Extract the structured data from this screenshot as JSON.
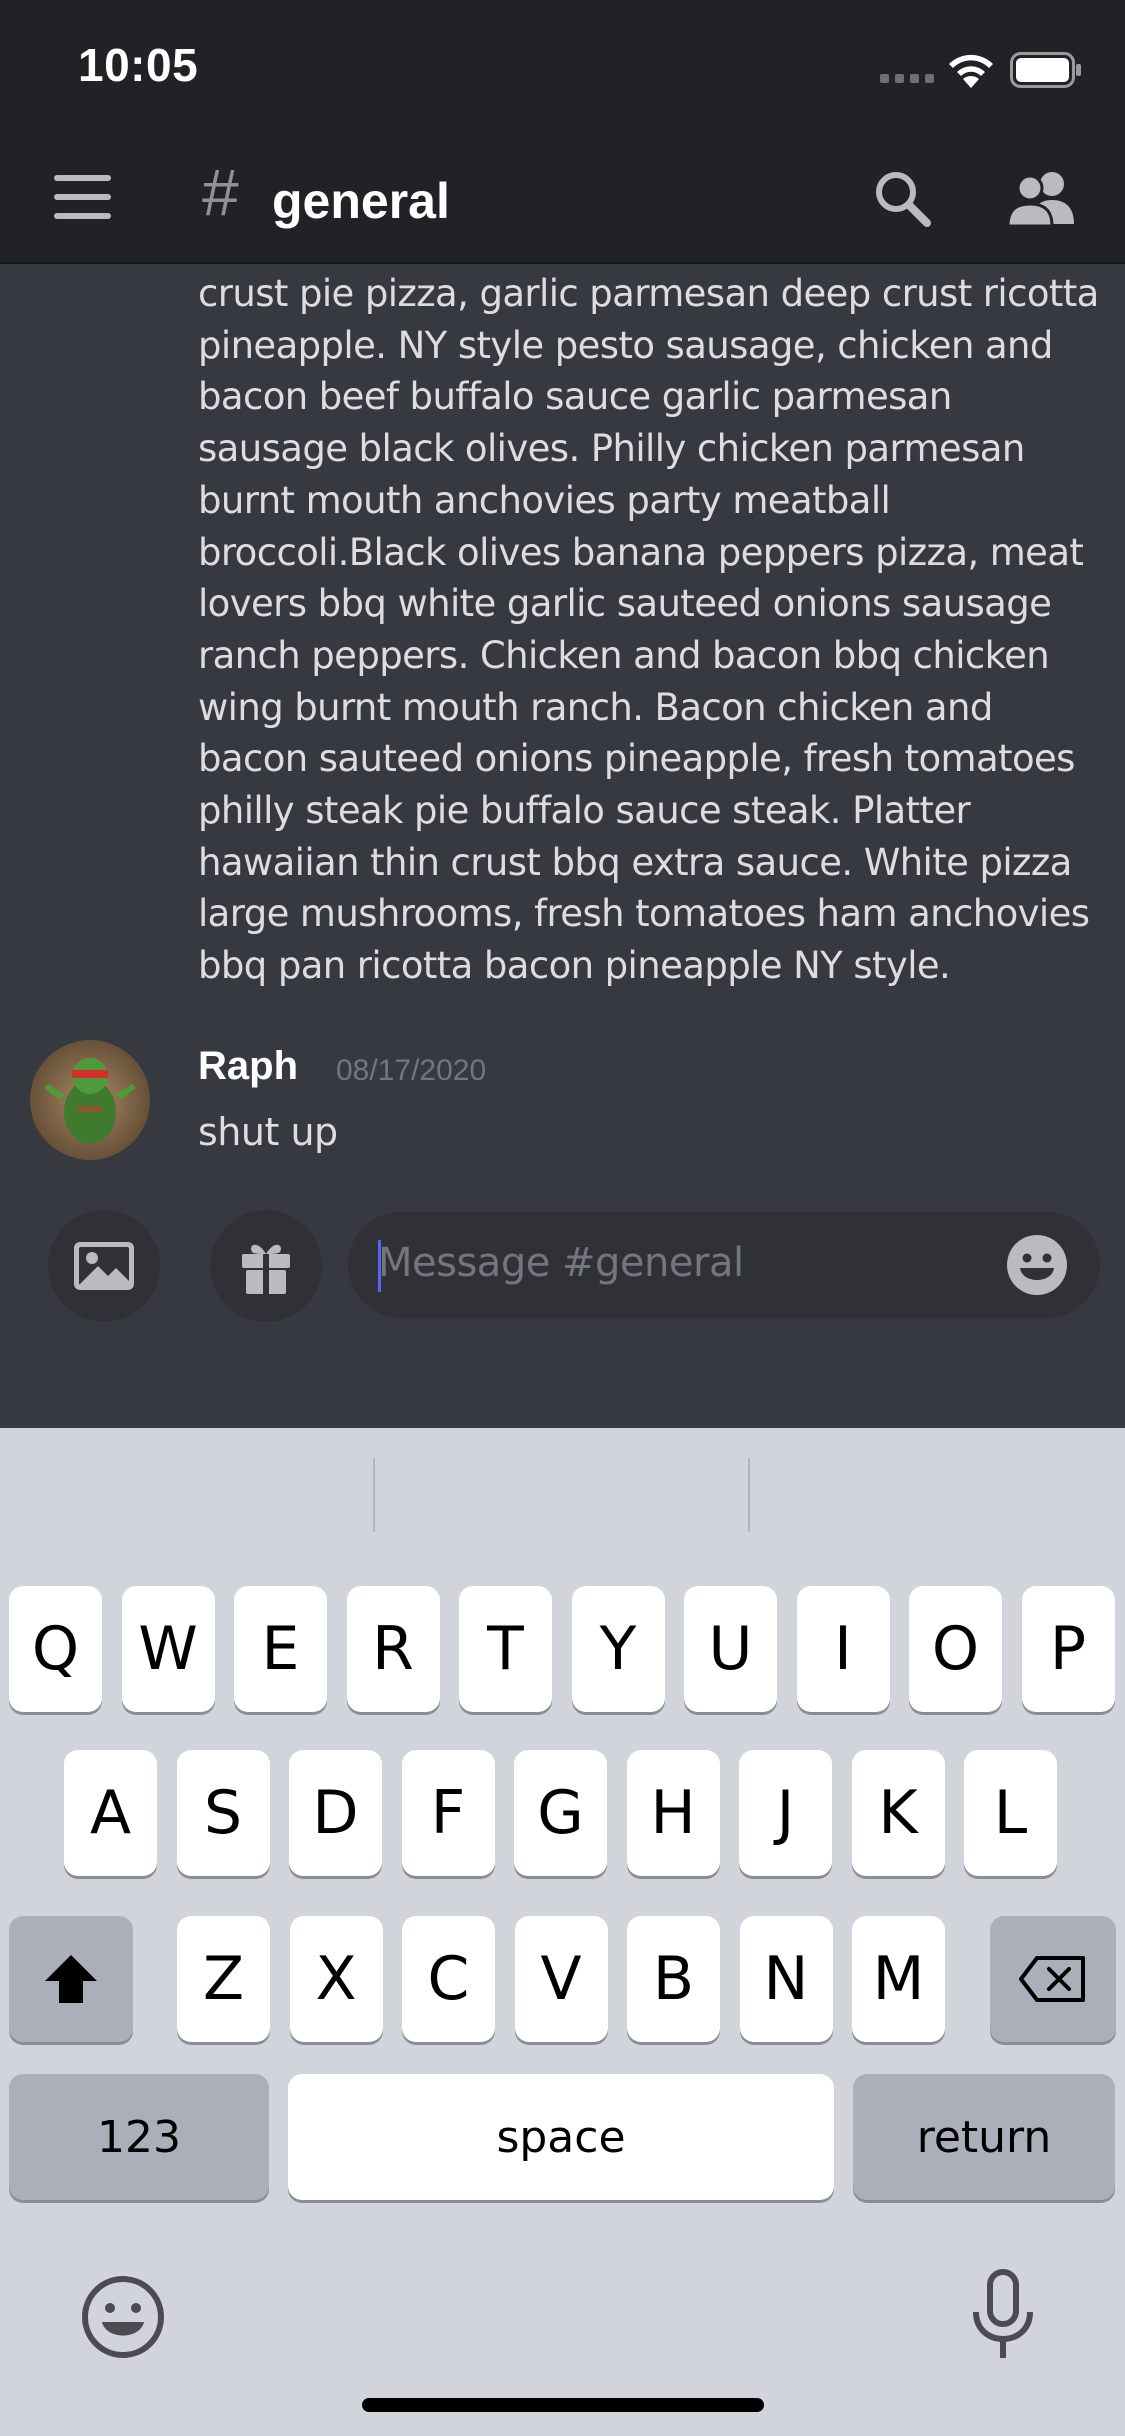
{
  "status_bar": {
    "time": "10:05"
  },
  "header": {
    "hash": "#",
    "channel": "general"
  },
  "messages": {
    "continued_text": "crust pie pizza, garlic parmesan deep crust ricotta pineapple. NY style pesto sausage, chicken and bacon beef buffalo sauce garlic parmesan sausage black olives. Philly chicken parmesan burnt mouth anchovies party meatball broccoli.Black olives banana peppers pizza, meat lovers bbq white garlic sauteed onions sausage ranch peppers. Chicken and bacon bbq chicken wing burnt mouth ranch. Bacon chicken and bacon sauteed onions pineapple, fresh tomatoes philly steak pie buffalo sauce steak. Platter hawaiian thin crust bbq extra sauce. White pizza large mushrooms, fresh tomatoes ham anchovies bbq pan ricotta bacon pineapple NY style.",
    "last": {
      "author": "Raph",
      "timestamp": "08/17/2020",
      "text": "shut up"
    }
  },
  "composer": {
    "placeholder": "Message #general"
  },
  "keyboard": {
    "row1": [
      "Q",
      "W",
      "E",
      "R",
      "T",
      "Y",
      "U",
      "I",
      "O",
      "P"
    ],
    "row2": [
      "A",
      "S",
      "D",
      "F",
      "G",
      "H",
      "J",
      "K",
      "L"
    ],
    "row3": [
      "Z",
      "X",
      "C",
      "V",
      "B",
      "N",
      "M"
    ],
    "numbers_label": "123",
    "space_label": "space",
    "return_label": "return"
  },
  "colors": {
    "background": "#36393f",
    "header": "#202225",
    "accent": "#5865f2"
  }
}
